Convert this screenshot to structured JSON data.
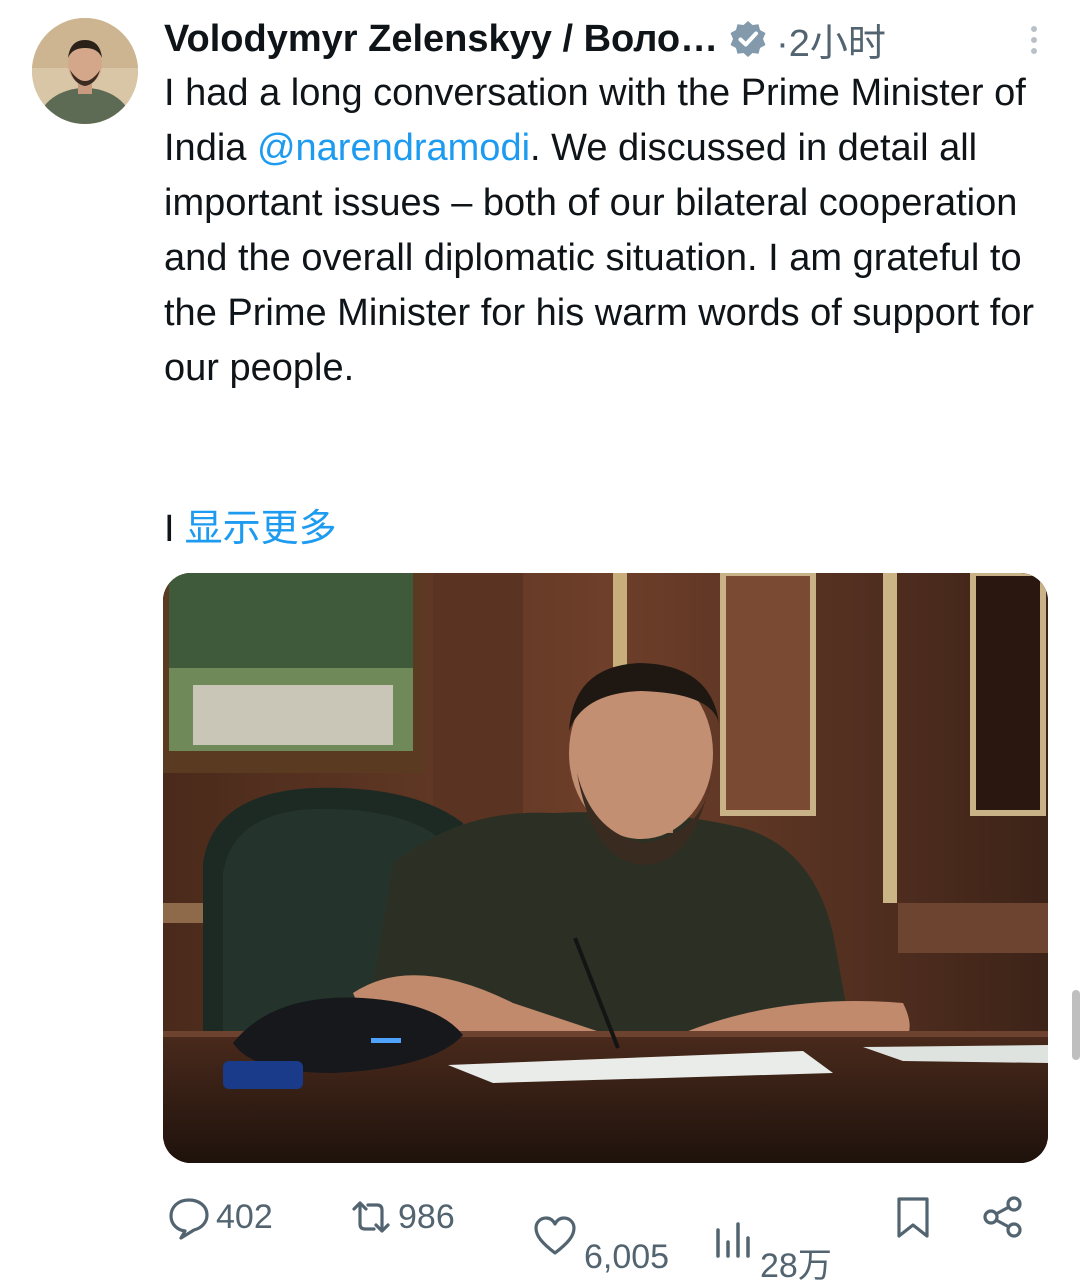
{
  "tweet": {
    "author_display": "Volodymyr Zelenskyy / Воло…",
    "separator": "·",
    "time": "2小时",
    "text_segments": [
      "I had a long conversation with the Prime Minister of India ",
      "@narendramodi",
      ". We discussed in detail all important issues – both of our bilateral cooperation and the overall diplomatic situation. I am grateful to the Prime Minister for his warm words of support for our people."
    ],
    "truncation_prefix": "I",
    "show_more_label": "显示更多"
  },
  "actions": {
    "replies": "402",
    "retweets": "986",
    "likes": "6,005",
    "views": "28万"
  },
  "colors": {
    "link": "#1d9bf0",
    "secondary_text": "#536471",
    "primary_text": "#0f1419"
  },
  "icons": [
    "verified-badge-icon",
    "more-options-icon",
    "reply-icon",
    "retweet-icon",
    "like-icon",
    "views-icon",
    "bookmark-icon",
    "share-icon"
  ]
}
